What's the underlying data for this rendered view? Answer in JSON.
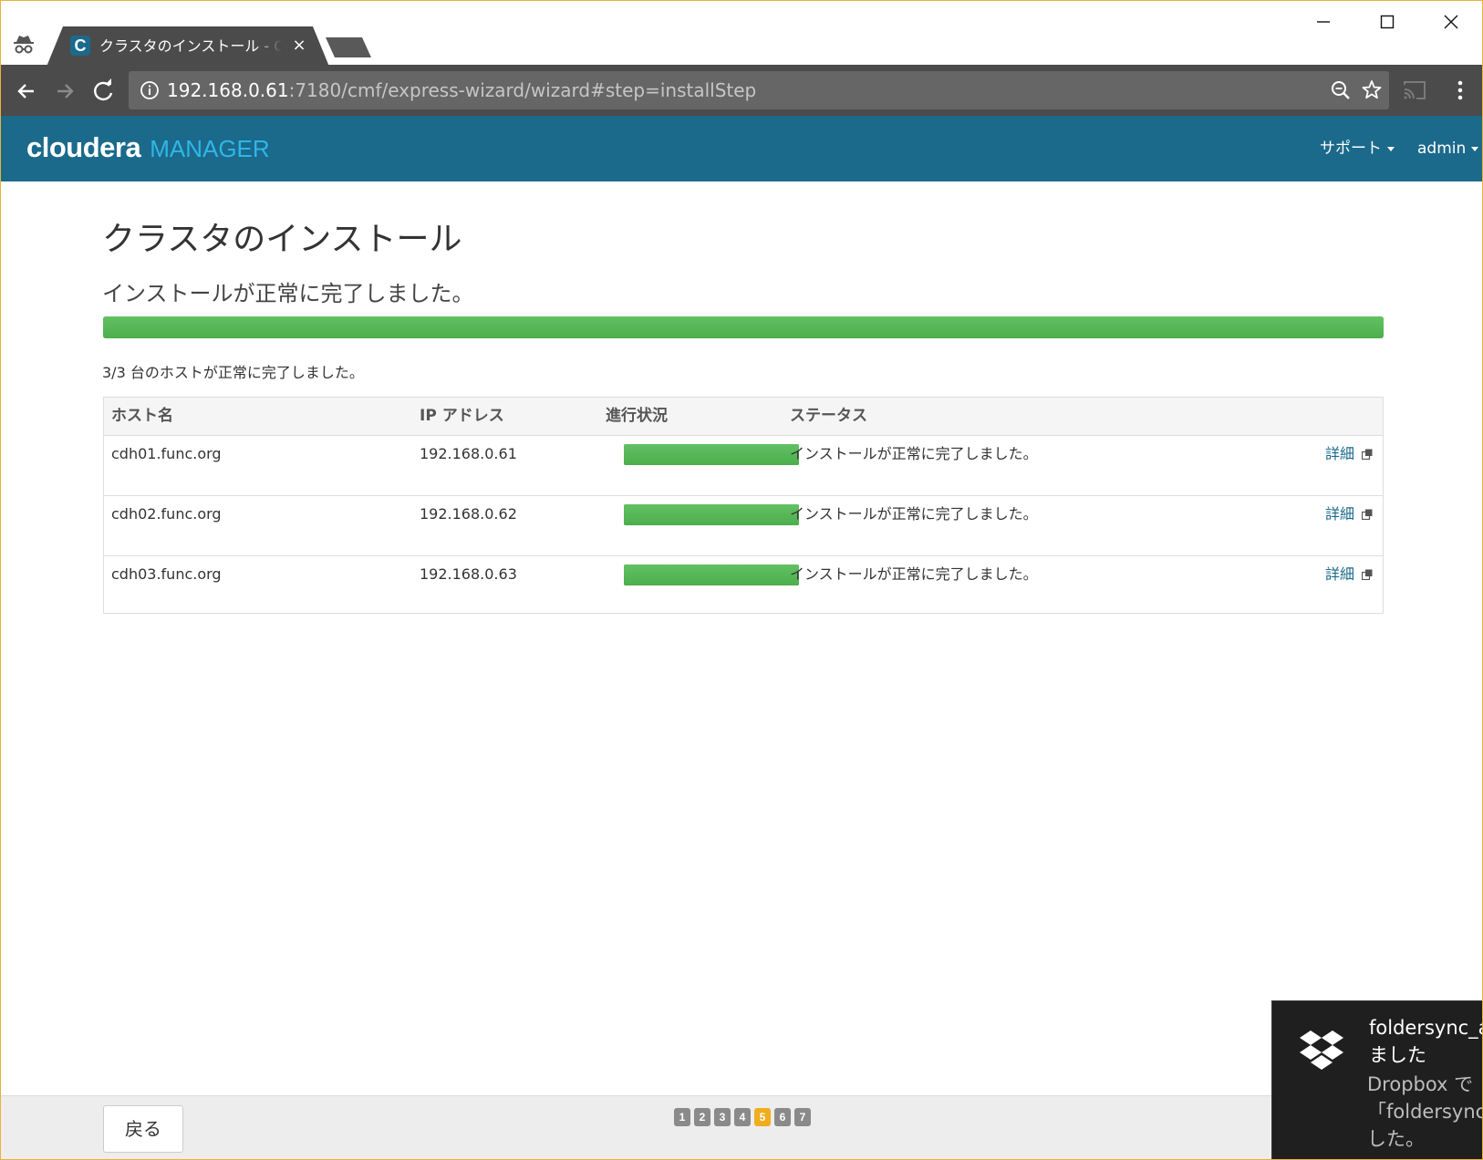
{
  "browser": {
    "tab_title": "クラスタのインストール - Cloudera Manager",
    "favicon_letter": "C",
    "tab_close": "×",
    "url_host": "192.168.0.61",
    "url_path": ":7180/cmf/express-wizard/wizard#step=installStep",
    "icons": [
      "incognito-icon",
      "back-icon",
      "forward-icon",
      "reload-icon",
      "info-icon",
      "zoom-icon",
      "star-icon",
      "cast-icon",
      "menu-icon",
      "minimize-icon",
      "maximize-icon",
      "close-icon"
    ]
  },
  "header": {
    "logo_main": "cloudera",
    "logo_sub": "MANAGER",
    "support_menu": "サポート",
    "admin_menu": "admin",
    "bg_color": "#1b6a8b"
  },
  "main": {
    "title": "クラスタのインストール",
    "status": "インストールが正常に完了しました。",
    "progress": 1.0,
    "summary": "3/3 台のホストが正常に完了しました。",
    "table": {
      "headers": [
        "ホスト名",
        "IP アドレス",
        "進行状況",
        "ステータス"
      ],
      "rows": [
        {
          "host": "cdh01.func.org",
          "ip": "192.168.0.61",
          "progress": 1.0,
          "status": "インストールが正常に完了しました。",
          "details": "詳細"
        },
        {
          "host": "cdh02.func.org",
          "ip": "192.168.0.62",
          "progress": 1.0,
          "status": "インストールが正常に完了しました。",
          "details": "詳細"
        },
        {
          "host": "cdh03.func.org",
          "ip": "192.168.0.63",
          "progress": 1.0,
          "status": "インストールが正常に完了しました。",
          "details": "詳細"
        }
      ]
    },
    "success_color": "#5cb85c"
  },
  "footer": {
    "back_label": "戻る",
    "steps": [
      "1",
      "2",
      "3",
      "4",
      "5",
      "6",
      "7"
    ],
    "current_step": "5",
    "active_color": "#f0ad1f"
  },
  "toast": {
    "title_line1": "foldersync_au",
    "title_line2": "ました",
    "body_line1": "Dropbox で",
    "body_line2": "「foldersync_a",
    "body_line3": "した。"
  }
}
